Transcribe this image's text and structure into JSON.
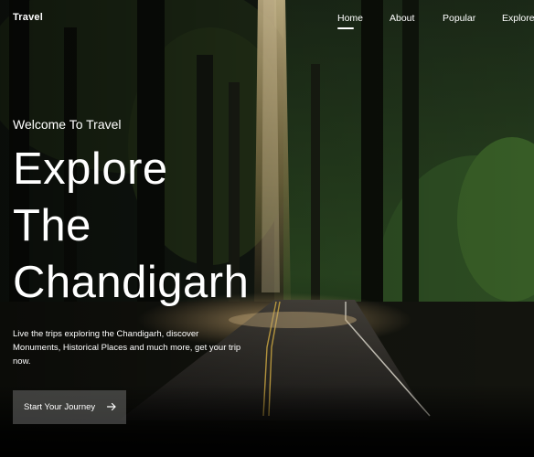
{
  "header": {
    "logo": "Travel",
    "nav": [
      {
        "label": "Home",
        "active": true
      },
      {
        "label": "About",
        "active": false
      },
      {
        "label": "Popular",
        "active": false
      },
      {
        "label": "Explore",
        "active": false
      }
    ]
  },
  "hero": {
    "subtitle": "Welcome To Travel",
    "headline": [
      "Explore",
      "The",
      "Chandigarh"
    ],
    "description": "Live the trips exploring the Chandigarh, discover Monuments, Historical Places and much more, get your trip now.",
    "cta_label": "Start Your Journey",
    "cta_icon": "arrow-right-icon",
    "background": "forest-road-image"
  },
  "colors": {
    "text": "#ffffff",
    "button_bg": "#5a5a58",
    "forest_dark": "#0d120c",
    "sunlight": "#e0c48a"
  }
}
